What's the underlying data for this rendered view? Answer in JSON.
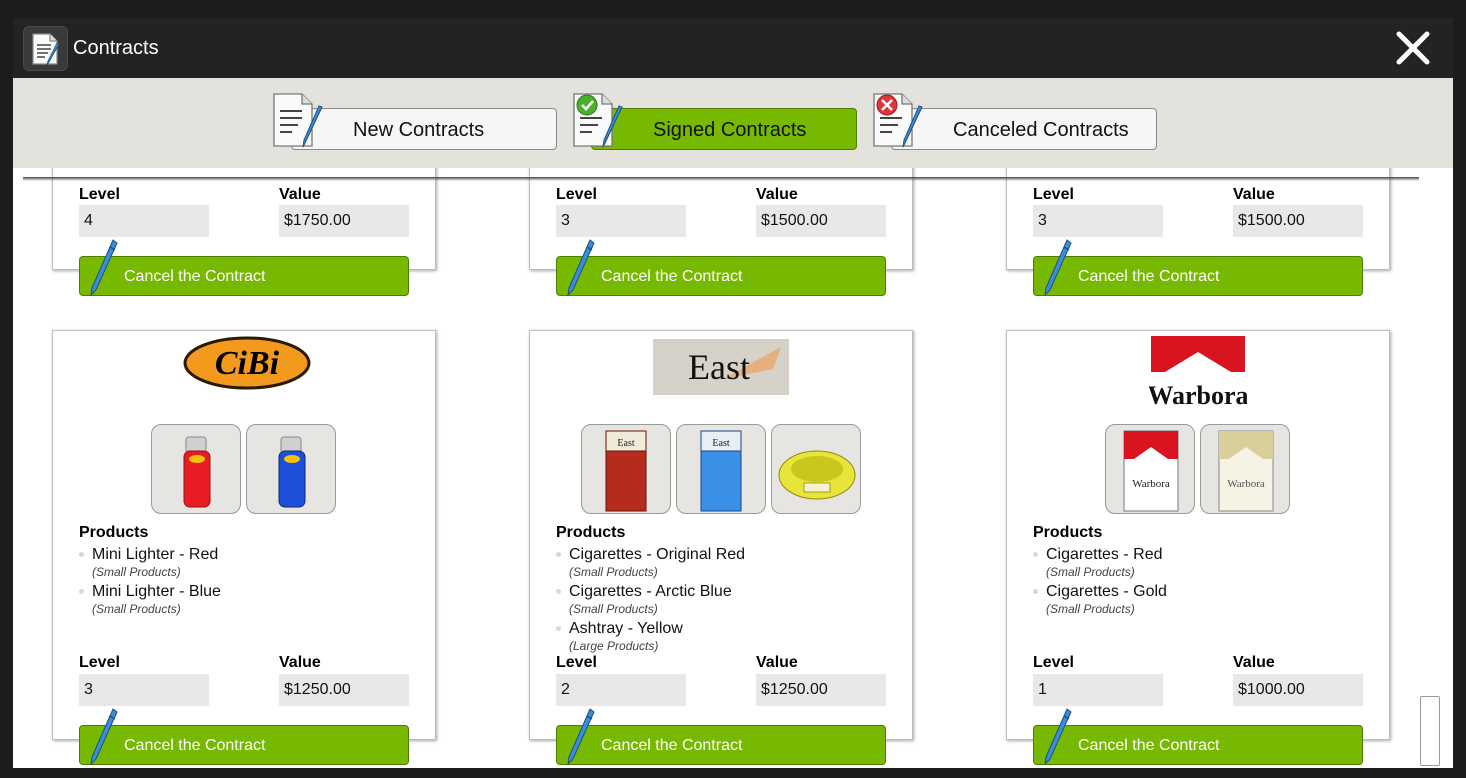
{
  "window": {
    "title": "Contracts"
  },
  "tabs": [
    {
      "label": "New Contracts",
      "icon": "contract-pen-icon"
    },
    {
      "label": "Signed Contracts",
      "icon": "contract-check-icon",
      "active": true
    },
    {
      "label": "Canceled Contracts",
      "icon": "contract-x-icon"
    }
  ],
  "labels": {
    "level": "Level",
    "value": "Value",
    "products": "Products",
    "cancel": "Cancel the Contract"
  },
  "top_cards": [
    {
      "level": "4",
      "value": "$1750.00"
    },
    {
      "level": "3",
      "value": "$1500.00"
    },
    {
      "level": "3",
      "value": "$1500.00"
    }
  ],
  "cards": [
    {
      "brand": "CiBi",
      "level": "3",
      "value": "$1250.00",
      "products": [
        {
          "name": "Mini Lighter - Red",
          "category": "(Small Products)"
        },
        {
          "name": "Mini Lighter - Blue",
          "category": "(Small Products)"
        }
      ]
    },
    {
      "brand": "East",
      "level": "2",
      "value": "$1250.00",
      "products": [
        {
          "name": "Cigarettes - Original Red",
          "category": "(Small Products)"
        },
        {
          "name": "Cigarettes - Arctic Blue",
          "category": "(Small Products)"
        },
        {
          "name": "Ashtray - Yellow",
          "category": "(Large Products)"
        }
      ]
    },
    {
      "brand": "Warbora",
      "level": "1",
      "value": "$1000.00",
      "products": [
        {
          "name": "Cigarettes - Red",
          "category": "(Small Products)"
        },
        {
          "name": "Cigarettes - Gold",
          "category": "(Small Products)"
        }
      ]
    }
  ],
  "colors": {
    "accent": "#76b900",
    "titlebar": "#232323",
    "tabbar": "#e3e2dd"
  }
}
